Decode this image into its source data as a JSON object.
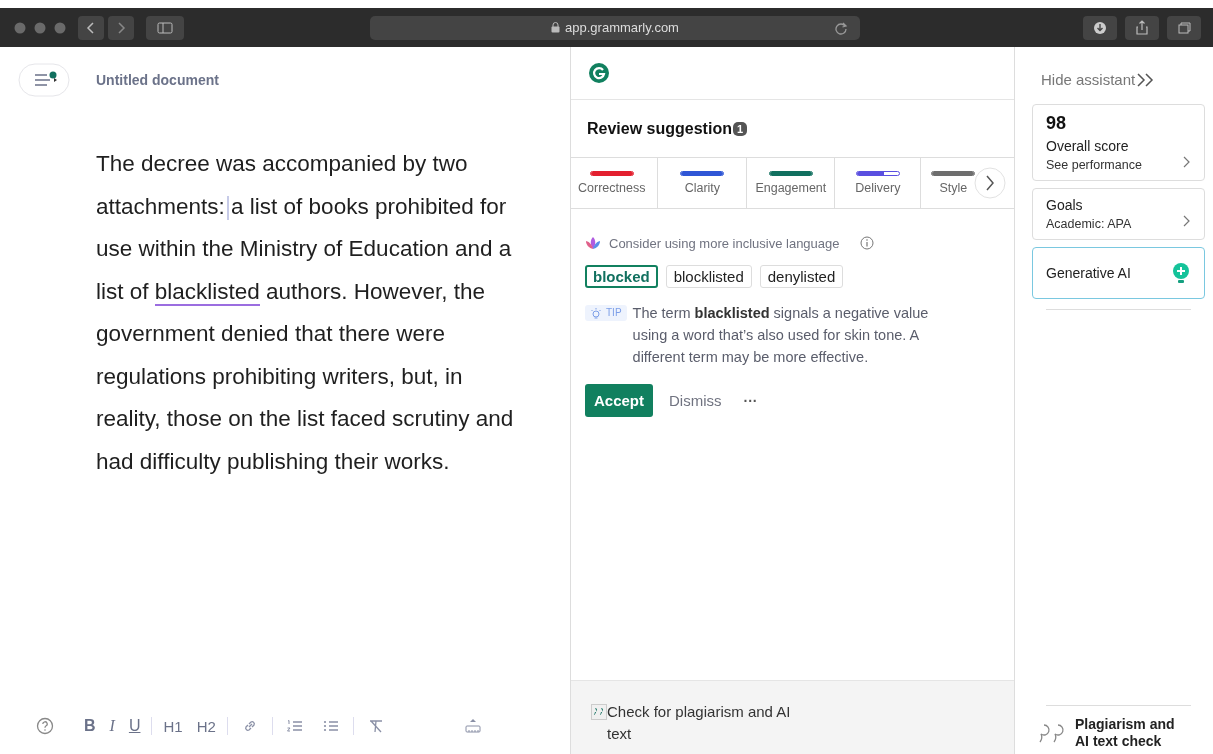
{
  "browser": {
    "address": "app.grammarly.com"
  },
  "editor": {
    "title": "Untitled document",
    "paragraph": [
      {
        "text": "The decree was accompanied by two attachments: ",
        "flagged": false
      },
      {
        "text": "a list of books prohibited for use within the Ministry of Education and a list of ",
        "flagged": false
      },
      {
        "text": "blacklisted",
        "flagged": true
      },
      {
        "text": " authors. However, the government denied that there were regulations prohibiting writers, but, in reality, those on the list faced scrutiny and had difficulty publishing their works.",
        "flagged": false
      }
    ],
    "toolbar": [
      {
        "kind": "help"
      },
      {
        "kind": "bold",
        "label": "B"
      },
      {
        "kind": "italic",
        "label": "I"
      },
      {
        "kind": "underline",
        "label": "U"
      },
      {
        "kind": "sep"
      },
      {
        "kind": "heading",
        "label": "H1"
      },
      {
        "kind": "heading",
        "label": "H2"
      },
      {
        "kind": "sep"
      },
      {
        "kind": "link"
      },
      {
        "kind": "sep"
      },
      {
        "kind": "numbered"
      },
      {
        "kind": "bullets"
      },
      {
        "kind": "sep"
      },
      {
        "kind": "clear"
      },
      {
        "kind": "ruler"
      }
    ]
  },
  "assistant": {
    "heading": "Review suggestion",
    "count": "1",
    "categories": [
      {
        "label": "Correctness",
        "color": "#e3202f",
        "level": 1
      },
      {
        "label": "Clarity",
        "color": "#2f56d6",
        "level": 1
      },
      {
        "label": "Engagement",
        "color": "#11705f",
        "level": 1
      },
      {
        "label": "Delivery",
        "color": "#5a4fe0",
        "level": 0.65
      },
      {
        "label": "Style",
        "color": "#6e6e6e",
        "level": 1
      }
    ],
    "suggestion": {
      "title": "Consider using more inclusive language",
      "options": [
        {
          "label": "blocked",
          "selected": true
        },
        {
          "label": "blocklisted",
          "selected": false
        },
        {
          "label": "denylisted",
          "selected": false
        }
      ],
      "tip_badge": "TIP",
      "tip": "The term **blacklisted** signals a negative value using a word that’s also used for skin tone. A different term may be more effective.",
      "accept": "Accept",
      "dismiss": "Dismiss",
      "more": "···"
    },
    "footer": "Check for plagiarism and AI text"
  },
  "sidebar": {
    "hide": "Hide assistant",
    "score": {
      "value": "98",
      "label": "Overall score",
      "link": "See performance"
    },
    "goals": {
      "label": "Goals",
      "value": "Academic: APA"
    },
    "generative": "Generative AI",
    "plagiarism": "Plagiarism and AI text check"
  }
}
